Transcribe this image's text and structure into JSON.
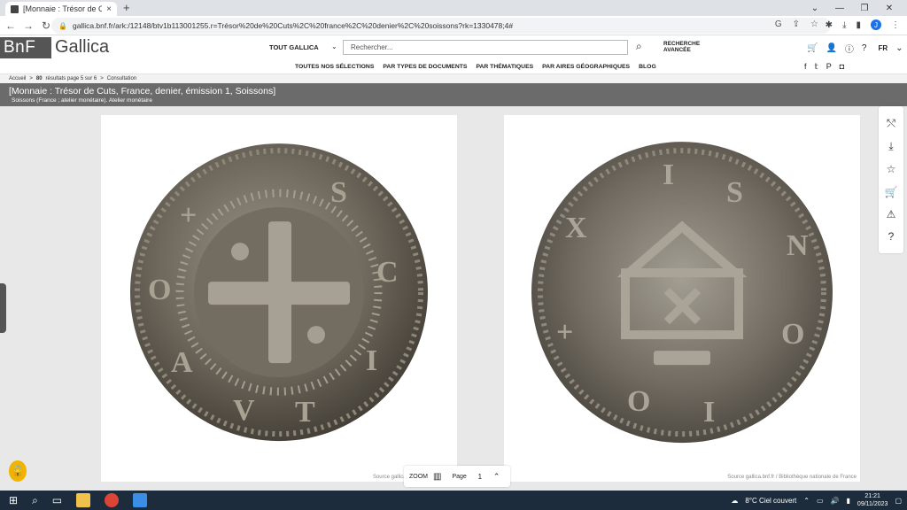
{
  "browser": {
    "tab_title": "[Monnaie : Trésor de Cuts, Franc",
    "tab_close": "×",
    "new_tab": "+",
    "url": "gallica.bnf.fr/ark:/12148/btv1b113001255.r=Trésor%20de%20Cuts%2C%20france%2C%20denier%2C%20soissons?rk=1330478;4#",
    "profile_initial": "J"
  },
  "header": {
    "logo_bnf": "BnF",
    "logo_gallica": "Gallica",
    "scope_label": "TOUT GALLICA",
    "search_placeholder": "Rechercher...",
    "advanced_search": "RECHERCHE AVANCÉE",
    "language": "FR"
  },
  "nav": {
    "items": [
      "TOUTES NOS SÉLECTIONS",
      "PAR TYPES DE DOCUMENTS",
      "PAR THÉMATIQUES",
      "PAR AIRES GÉOGRAPHIQUES",
      "BLOG"
    ]
  },
  "breadcrumb": {
    "home": "Accueil",
    "sep": ">",
    "results_count": "80",
    "results_text": "résultats page 5 sur 6",
    "current": "Consultation"
  },
  "document": {
    "title": "[Monnaie : Trésor de Cuts, France, denier, émission 1, Soissons]",
    "subtitle": "Soissons (France ; atelier monétaire). Atelier monétaire"
  },
  "viewer": {
    "left_source": "Source gallica.bnf.fr / Bibliothèque",
    "right_source": "Source gallica.bnf.fr / Bibliothèque nationale de France",
    "zoom_label": "ZOOM",
    "page_label": "Page",
    "page_value": "1"
  },
  "taskbar": {
    "weather": "8°C  Ciel couvert",
    "time": "21:21",
    "date": "09/11/2023"
  }
}
